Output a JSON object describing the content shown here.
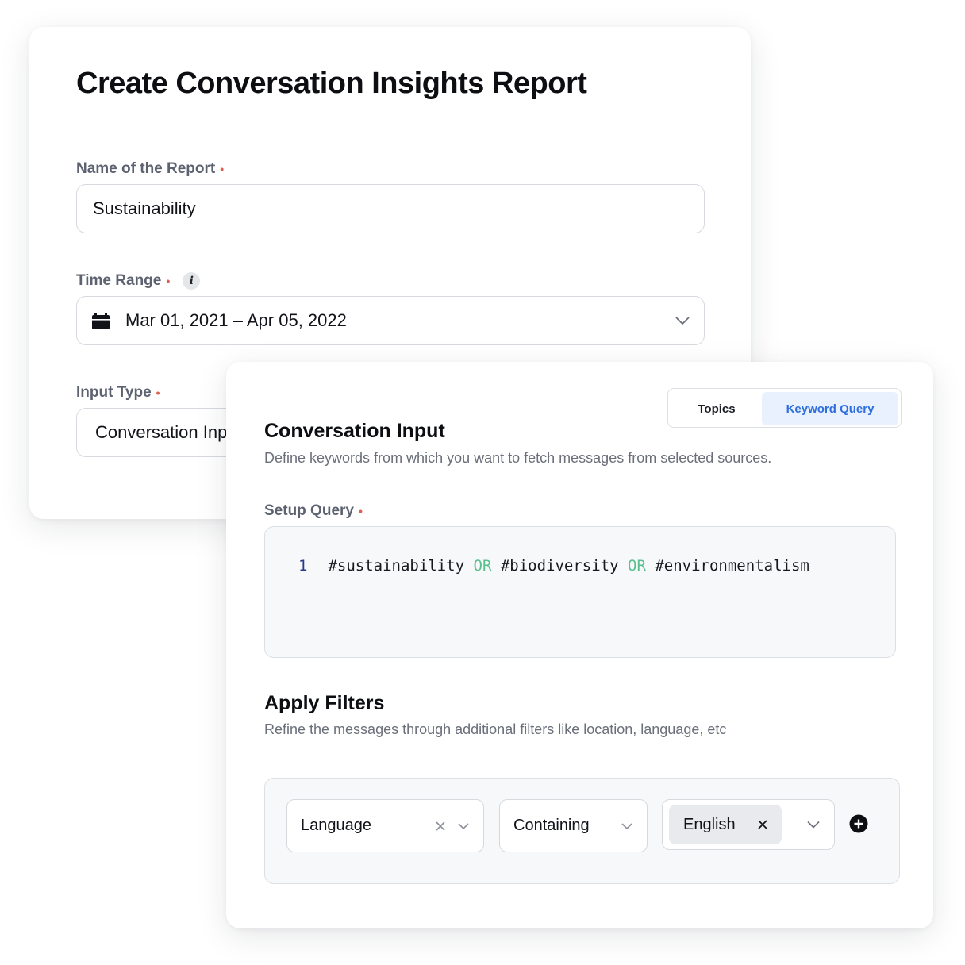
{
  "report_form": {
    "title": "Create Conversation Insights Report",
    "name_field": {
      "label": "Name of the Report",
      "required_marker": "•",
      "value": "Sustainability"
    },
    "time_range": {
      "label": "Time Range",
      "required_marker": "•",
      "info_icon": "info-icon",
      "value": "Mar 01, 2021 – Apr 05, 2022",
      "icon": "calendar-icon"
    },
    "input_type": {
      "label": "Input Type",
      "required_marker": "•",
      "value": "Conversation Inp"
    }
  },
  "conversation_input": {
    "tabs": [
      {
        "label": "Topics",
        "selected": false
      },
      {
        "label": "Keyword Query",
        "selected": true
      }
    ],
    "title": "Conversation Input",
    "description": "Define keywords from which you want to fetch messages from selected sources.",
    "setup_query": {
      "label": "Setup Query",
      "required_marker": "•",
      "line_number": "1",
      "tokens": [
        "#sustainability",
        "OR",
        "#biodiversity",
        "OR",
        "#environmentalism"
      ]
    },
    "filters": {
      "title": "Apply Filters",
      "description": "Refine the messages through additional filters like location, language, etc",
      "field": "Language",
      "operator": "Containing",
      "value_chip": "English"
    }
  },
  "colors": {
    "accent": "#2f6fdd",
    "accent_bg": "#e9f1ff",
    "required": "#e35d4c",
    "query_operator": "#58c08f"
  }
}
